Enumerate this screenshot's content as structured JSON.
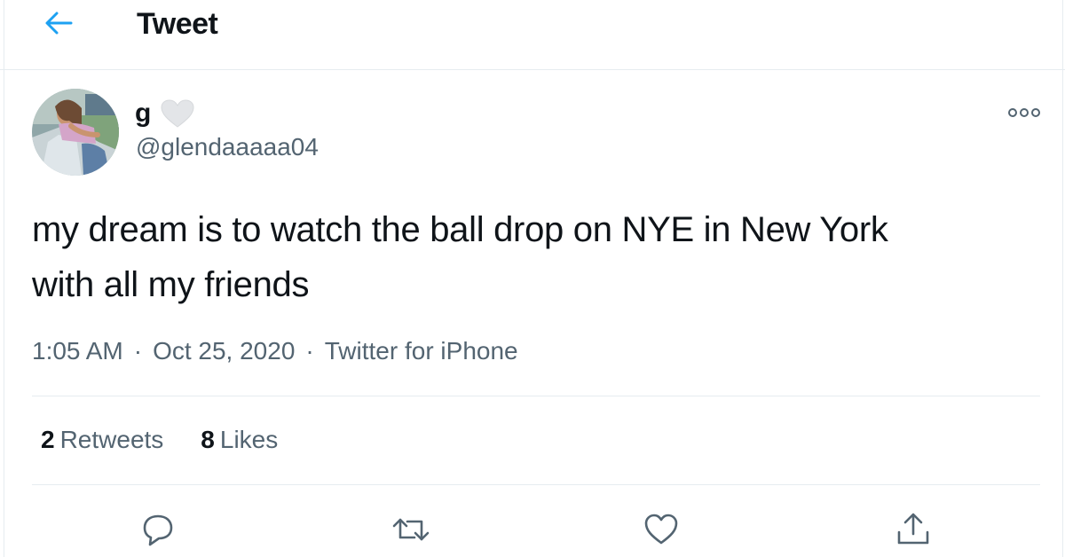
{
  "header": {
    "title": "Tweet",
    "back_icon": "arrow-left-icon",
    "accent_color": "#1da1f2"
  },
  "author": {
    "display_name": "g",
    "name_emoji": "white-heart-icon",
    "handle": "@glendaaaaa04",
    "avatar": "profile-photo"
  },
  "tweet": {
    "text_lines": [
      "my dream is to watch the ball drop on NYE in New York",
      "with all my friends"
    ],
    "time": "1:05 AM",
    "date": "Oct 25, 2020",
    "separator": "·",
    "source": "Twitter for iPhone"
  },
  "stats": {
    "retweets_count": "2",
    "retweets_label": "Retweets",
    "likes_count": "8",
    "likes_label": "Likes"
  },
  "actions": [
    "reply-icon",
    "retweet-icon",
    "like-icon",
    "share-icon"
  ],
  "colors": {
    "text": "#0f1419",
    "secondary": "#536471",
    "divider": "#e6ecf0",
    "icon": "#536471"
  }
}
